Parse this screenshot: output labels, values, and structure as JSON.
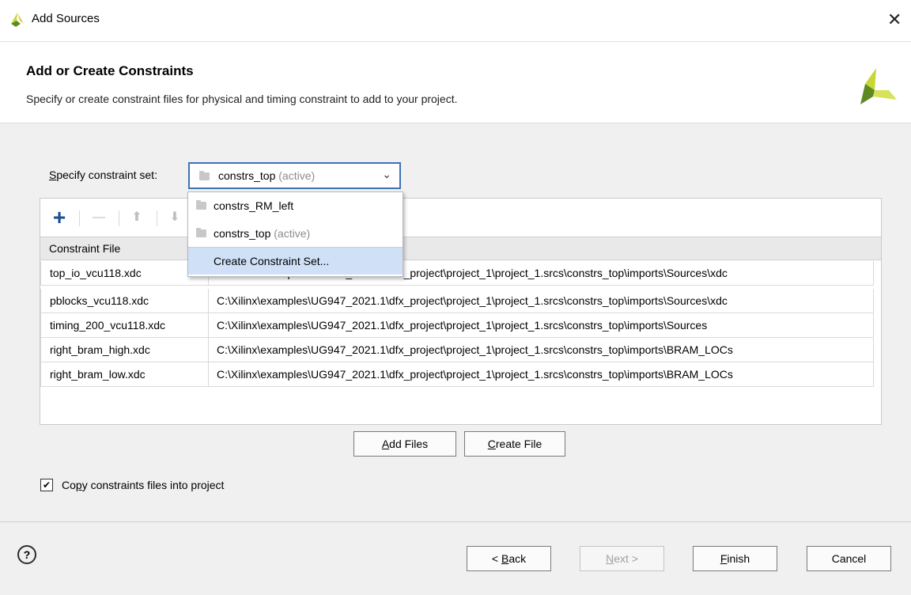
{
  "window": {
    "title": "Add Sources",
    "close_glyph": "✕"
  },
  "header": {
    "title": "Add or Create Constraints",
    "subtitle": "Specify or create constraint files for physical and timing constraint to add to your project."
  },
  "constraint_set": {
    "label_pre": "S",
    "label_post": "pecify constraint set:",
    "selected_name": "constrs_top",
    "selected_suffix": "(active)",
    "chevron": "⌄"
  },
  "dropdown": {
    "options": [
      {
        "name": "constrs_RM_left",
        "suffix": ""
      },
      {
        "name": "constrs_top",
        "suffix": "(active)"
      }
    ],
    "create_label": "Create Constraint Set..."
  },
  "toolbar": {
    "add_glyph": "+",
    "remove_glyph": "—",
    "up_glyph": "⬆",
    "down_glyph": "⬇"
  },
  "table": {
    "column_header": "Constraint File",
    "rows": [
      {
        "file": "top_io_vcu118.xdc",
        "path": "C:\\Xilinx\\examples\\UG947_2021.1\\dfx_project\\project_1\\project_1.srcs\\constrs_top\\imports\\Sources\\xdc"
      },
      {
        "file": "pblocks_vcu118.xdc",
        "path": "C:\\Xilinx\\examples\\UG947_2021.1\\dfx_project\\project_1\\project_1.srcs\\constrs_top\\imports\\Sources\\xdc"
      },
      {
        "file": "timing_200_vcu118.xdc",
        "path": "C:\\Xilinx\\examples\\UG947_2021.1\\dfx_project\\project_1\\project_1.srcs\\constrs_top\\imports\\Sources"
      },
      {
        "file": "right_bram_high.xdc",
        "path": "C:\\Xilinx\\examples\\UG947_2021.1\\dfx_project\\project_1\\project_1.srcs\\constrs_top\\imports\\BRAM_LOCs"
      },
      {
        "file": "right_bram_low.xdc",
        "path": "C:\\Xilinx\\examples\\UG947_2021.1\\dfx_project\\project_1\\project_1.srcs\\constrs_top\\imports\\BRAM_LOCs"
      }
    ]
  },
  "buttons": {
    "add_files_u": "A",
    "add_files_rest": "dd Files",
    "create_file_u": "C",
    "create_file_rest": "reate File"
  },
  "copy_option": {
    "label_pre": "Co",
    "label_u": "p",
    "label_post": "y constraints files into project",
    "checked_glyph": "✔"
  },
  "footer": {
    "help_glyph": "?",
    "back_pre": "< ",
    "back_u": "B",
    "back_post": "ack",
    "next_u": "N",
    "next_post": "ext >",
    "finish_u": "F",
    "finish_post": "inish",
    "cancel_label": "Cancel"
  },
  "colors": {
    "accent": "#3f72b4",
    "selection": "#cfe0f7",
    "logo_yellow": "#c7d734",
    "logo_green": "#5e8a24"
  }
}
